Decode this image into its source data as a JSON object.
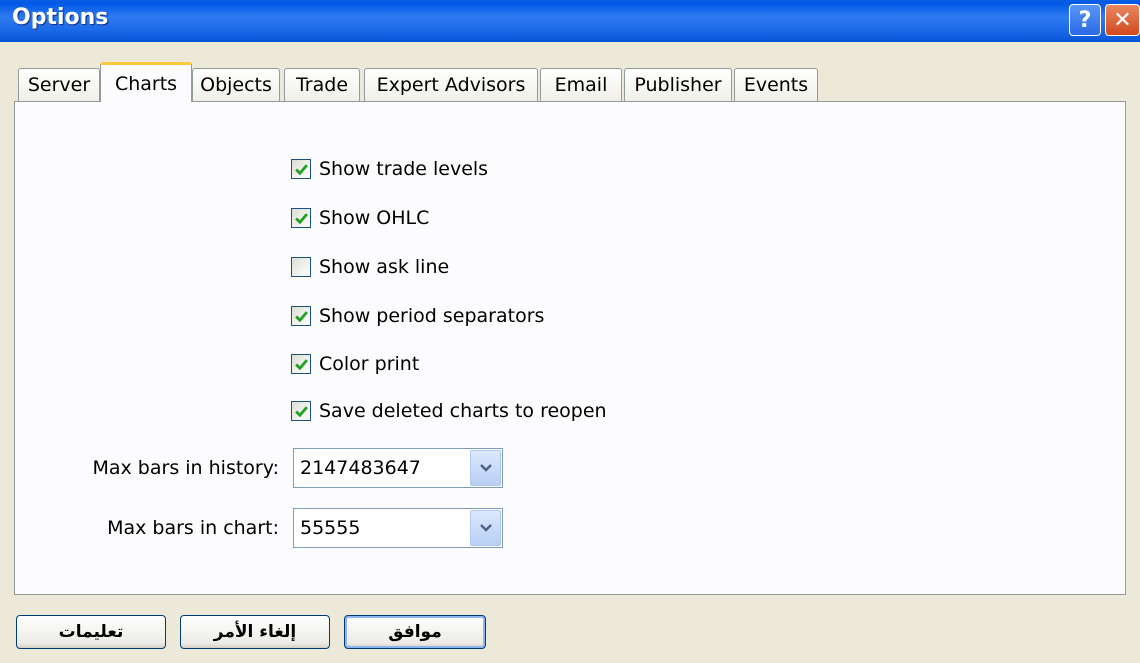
{
  "window": {
    "title": "Options",
    "help_label": "?",
    "close_label": "✕"
  },
  "tabs": [
    {
      "label": "Server",
      "active": false
    },
    {
      "label": "Charts",
      "active": true
    },
    {
      "label": "Objects",
      "active": false
    },
    {
      "label": "Trade",
      "active": false
    },
    {
      "label": "Expert Advisors",
      "active": false
    },
    {
      "label": "Email",
      "active": false
    },
    {
      "label": "Publisher",
      "active": false
    },
    {
      "label": "Events",
      "active": false
    }
  ],
  "options": [
    {
      "label": "Show trade levels",
      "checked": true
    },
    {
      "label": "Show OHLC",
      "checked": true
    },
    {
      "label": "Show ask line",
      "checked": false
    },
    {
      "label": "Show period separators",
      "checked": true
    },
    {
      "label": "Color print",
      "checked": true
    },
    {
      "label": "Save deleted charts to reopen",
      "checked": true
    }
  ],
  "fields": {
    "max_bars_history": {
      "label": "Max bars in history:",
      "value": "2147483647"
    },
    "max_bars_chart": {
      "label": "Max bars in chart:",
      "value": "55555"
    }
  },
  "buttons": {
    "ok": "موافق",
    "cancel": "إلغاء الأمر",
    "help": "تعليمات"
  },
  "colors": {
    "checkmark": "#21a121",
    "active_tab_accent": "#ffc83c",
    "titlebar": "#0058e6"
  },
  "icons": {
    "help": "question-mark-icon",
    "close": "close-icon",
    "dropdown": "chevron-down-icon",
    "check": "checkmark-icon"
  }
}
